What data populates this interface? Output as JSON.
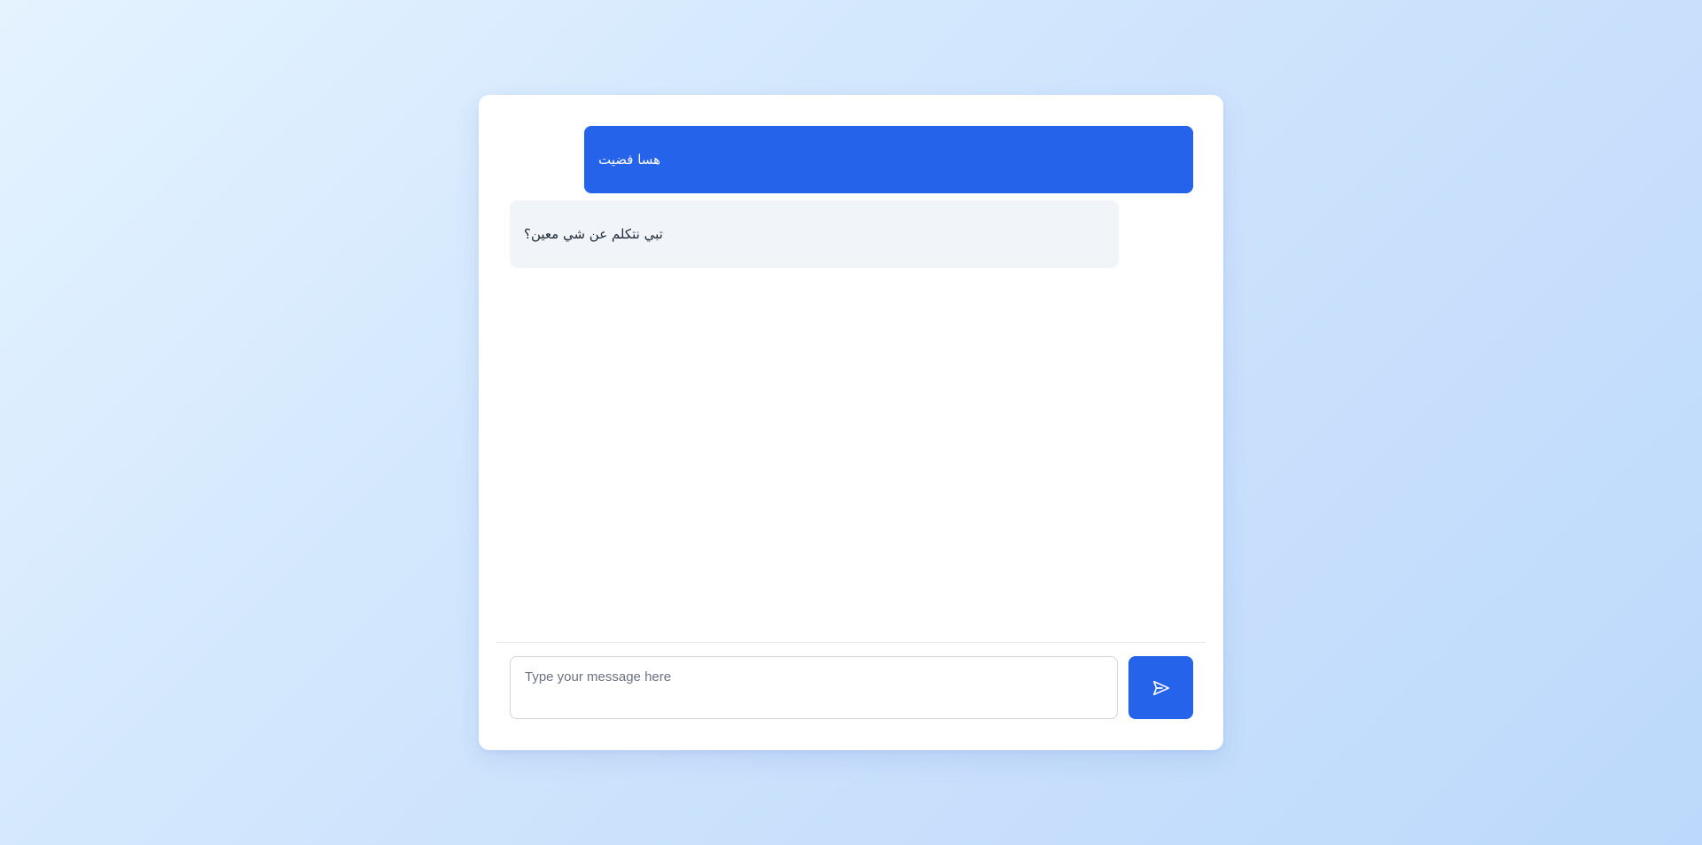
{
  "chat": {
    "messages": [
      {
        "role": "user",
        "text": "هسا فضيت"
      },
      {
        "role": "assistant",
        "text": "تبي نتكلم عن شي معين؟"
      }
    ]
  },
  "composer": {
    "placeholder": "Type your message here",
    "value": "",
    "send_icon": "send-icon"
  },
  "colors": {
    "accent": "#2563eb",
    "assistant_bubble": "#f1f5f9",
    "card": "#ffffff"
  }
}
